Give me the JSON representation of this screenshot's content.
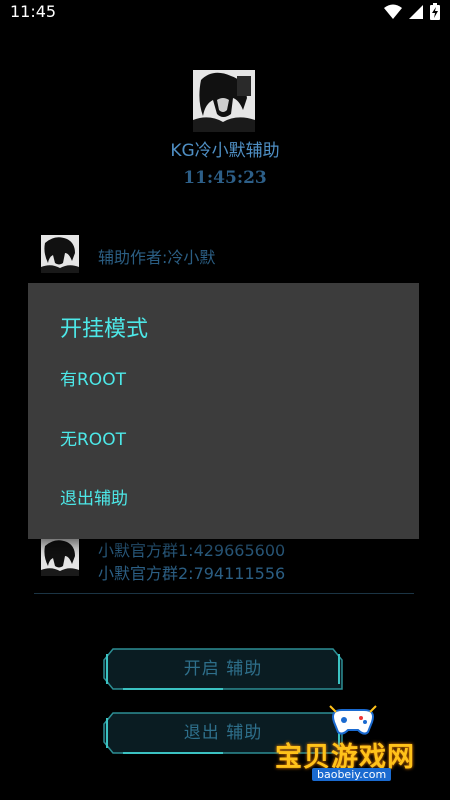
{
  "status_bar": {
    "time": "11:45"
  },
  "app": {
    "title": "KG冷小默辅助",
    "clock": "11:45:23"
  },
  "author": {
    "text": "辅助作者:冷小默"
  },
  "groups": {
    "group1": "小默官方群1:429665600",
    "group2": "小默官方群2:794111556"
  },
  "buttons": {
    "start_label": "开启 辅助",
    "exit_label": "退出 辅助"
  },
  "dialog": {
    "title": "开挂模式",
    "options": [
      "有ROOT",
      "无ROOT",
      "退出辅助"
    ]
  },
  "watermark": {
    "big": "宝贝游戏网",
    "small": "baobeiy.com"
  },
  "colors": {
    "background": "#000000",
    "accent_cyan": "#4de8e8",
    "text_blue": "#2b5e83",
    "dialog_bg": "#3c3c3c"
  }
}
